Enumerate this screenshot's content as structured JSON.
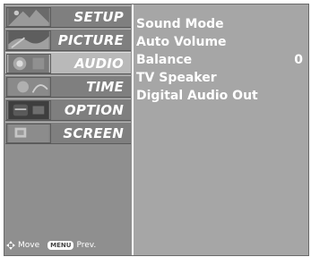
{
  "menu": {
    "items": [
      {
        "label": "SETUP",
        "icon": "setup-thumbnail-icon",
        "selected": false
      },
      {
        "label": "PICTURE",
        "icon": "picture-thumbnail-icon",
        "selected": false
      },
      {
        "label": "AUDIO",
        "icon": "audio-thumbnail-icon",
        "selected": true
      },
      {
        "label": "TIME",
        "icon": "time-thumbnail-icon",
        "selected": false
      },
      {
        "label": "OPTION",
        "icon": "option-thumbnail-icon",
        "selected": false
      },
      {
        "label": "SCREEN",
        "icon": "screen-thumbnail-icon",
        "selected": false
      }
    ]
  },
  "footer": {
    "move_label": "Move",
    "menu_key": "MENU",
    "prev_label": "Prev."
  },
  "audio": {
    "options": [
      {
        "label": "Sound Mode",
        "value": ""
      },
      {
        "label": "Auto Volume",
        "value": ""
      },
      {
        "label": "Balance",
        "value": "0"
      },
      {
        "label": "TV Speaker",
        "value": ""
      },
      {
        "label": "Digital Audio Out",
        "value": ""
      }
    ]
  },
  "colors": {
    "panel": "#a6a6a6",
    "sidebar": "#8f8f8f",
    "item": "#7f7f7f",
    "selected_item": "#b9b9b9",
    "text": "#ffffff"
  }
}
